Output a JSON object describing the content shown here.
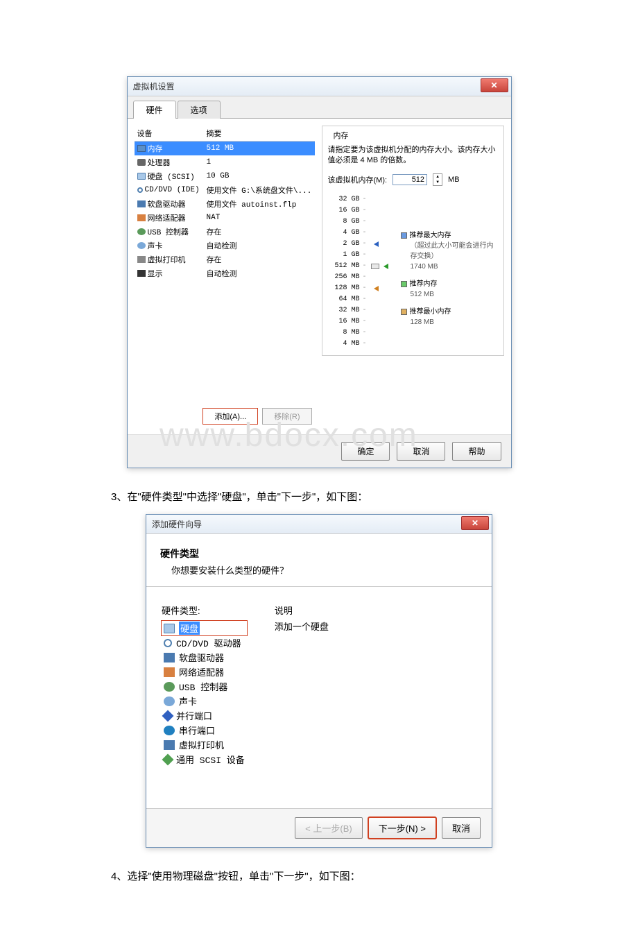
{
  "dialog1": {
    "title": "虚拟机设置",
    "tabs": {
      "hardware": "硬件",
      "options": "选项"
    },
    "cols": {
      "device": "设备",
      "summary": "摘要"
    },
    "rows": [
      {
        "name": "内存",
        "val": "512 MB"
      },
      {
        "name": "处理器",
        "val": "1"
      },
      {
        "name": "硬盘 (SCSI)",
        "val": "10 GB"
      },
      {
        "name": "CD/DVD (IDE)",
        "val": "使用文件 G:\\系统盘文件\\..."
      },
      {
        "name": "软盘驱动器",
        "val": "使用文件 autoinst.flp"
      },
      {
        "name": "网络适配器",
        "val": "NAT"
      },
      {
        "name": "USB 控制器",
        "val": "存在"
      },
      {
        "name": "声卡",
        "val": "自动检测"
      },
      {
        "name": "虚拟打印机",
        "val": "存在"
      },
      {
        "name": "显示",
        "val": "自动检测"
      }
    ],
    "add": "添加(A)...",
    "remove": "移除(R)",
    "mem_title": "内存",
    "mem_desc": "请指定要为该虚拟机分配的内存大小。该内存大小值必须是 4 MB 的倍数。",
    "mem_label": "该虚拟机内存(M):",
    "mem_value": "512",
    "mem_unit": "MB",
    "scale": [
      "32 GB",
      "16 GB",
      "8 GB",
      "4 GB",
      "2 GB",
      "1 GB",
      "512 MB",
      "256 MB",
      "128 MB",
      "64 MB",
      "32 MB",
      "16 MB",
      "8 MB",
      "4 MB"
    ],
    "legend_max": "推荐最大内存",
    "legend_max_note": "（超过此大小可能会进行内存交换）",
    "legend_max_val": "1740 MB",
    "legend_rec": "推荐内存",
    "legend_rec_val": "512 MB",
    "legend_min": "推荐最小内存",
    "legend_min_val": "128 MB",
    "ok": "确定",
    "cancel": "取消",
    "help": "帮助"
  },
  "step3": "3、在\"硬件类型\"中选择\"硬盘\"，单击\"下一步\"，如下图：",
  "watermark": "www.bdocx.com",
  "dialog2": {
    "title": "添加硬件向导",
    "header": "硬件类型",
    "subtitle": "你想要安装什么类型的硬件？",
    "list_label": "硬件类型:",
    "items": [
      "硬盘",
      "CD/DVD 驱动器",
      "软盘驱动器",
      "网络适配器",
      "USB 控制器",
      "声卡",
      "并行端口",
      "串行端口",
      "虚拟打印机",
      "通用 SCSI 设备"
    ],
    "desc_label": "说明",
    "desc_text": "添加一个硬盘",
    "back": "< 上一步(B)",
    "next": "下一步(N) >",
    "cancel": "取消"
  },
  "step4": "4、选择\"使用物理磁盘\"按钮，单击\"下一步\"，如下图："
}
